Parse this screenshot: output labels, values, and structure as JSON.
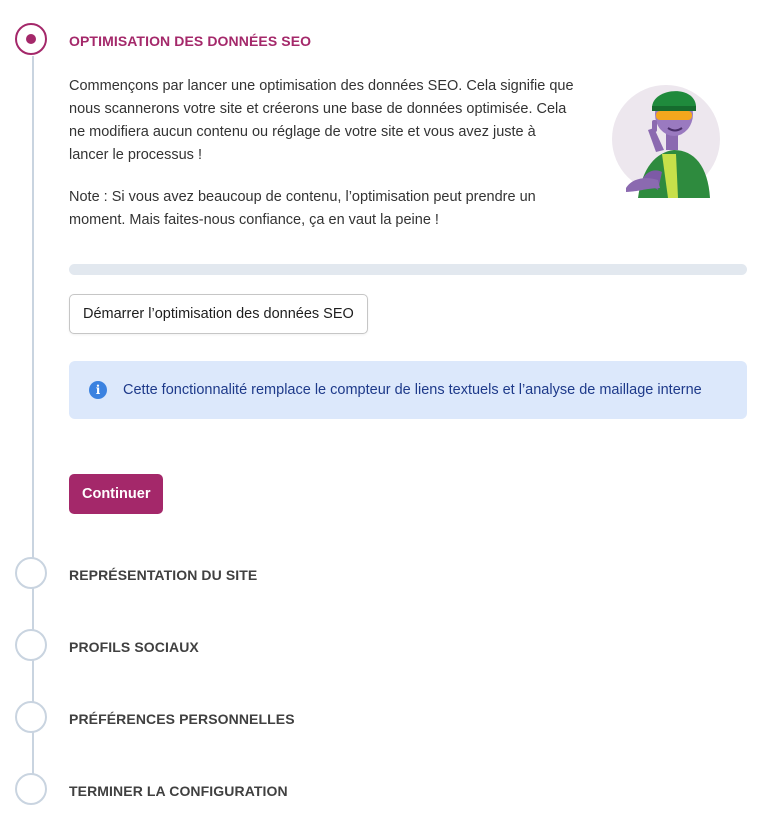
{
  "steps": [
    {
      "title": "OPTIMISATION DES DONNÉES SEO",
      "state": "active"
    },
    {
      "title": "REPRÉSENTATION DU SITE",
      "state": "pending"
    },
    {
      "title": "PROFILS SOCIAUX",
      "state": "pending"
    },
    {
      "title": "PRÉFÉRENCES PERSONNELLES",
      "state": "pending"
    },
    {
      "title": "TERMINER LA CONFIGURATION",
      "state": "pending"
    }
  ],
  "content": {
    "paragraph1": "Commençons par lancer une optimisation des données SEO. Cela signifie que nous scannerons votre site et créerons une base de données optimisée. Cela ne modifiera aucun contenu ou réglage de votre site et vous avez juste à lancer le processus !",
    "paragraph2": "Note : Si vous avez beaucoup de contenu, l’optimisation peut prendre un moment. Mais faites-nous confiance, ça en vaut la peine !",
    "progress_percent": 0,
    "start_button": "Démarrer l’optimisation des données SEO",
    "notice": "Cette fonctionnalité remplace le compteur de liens textuels et l’analyse de maillage interne",
    "continue_button": "Continuer"
  },
  "colors": {
    "accent": "#a4286a",
    "rail": "#c9d4e0",
    "notice_bg": "#dce8fb",
    "info_icon": "#3b82e0"
  }
}
